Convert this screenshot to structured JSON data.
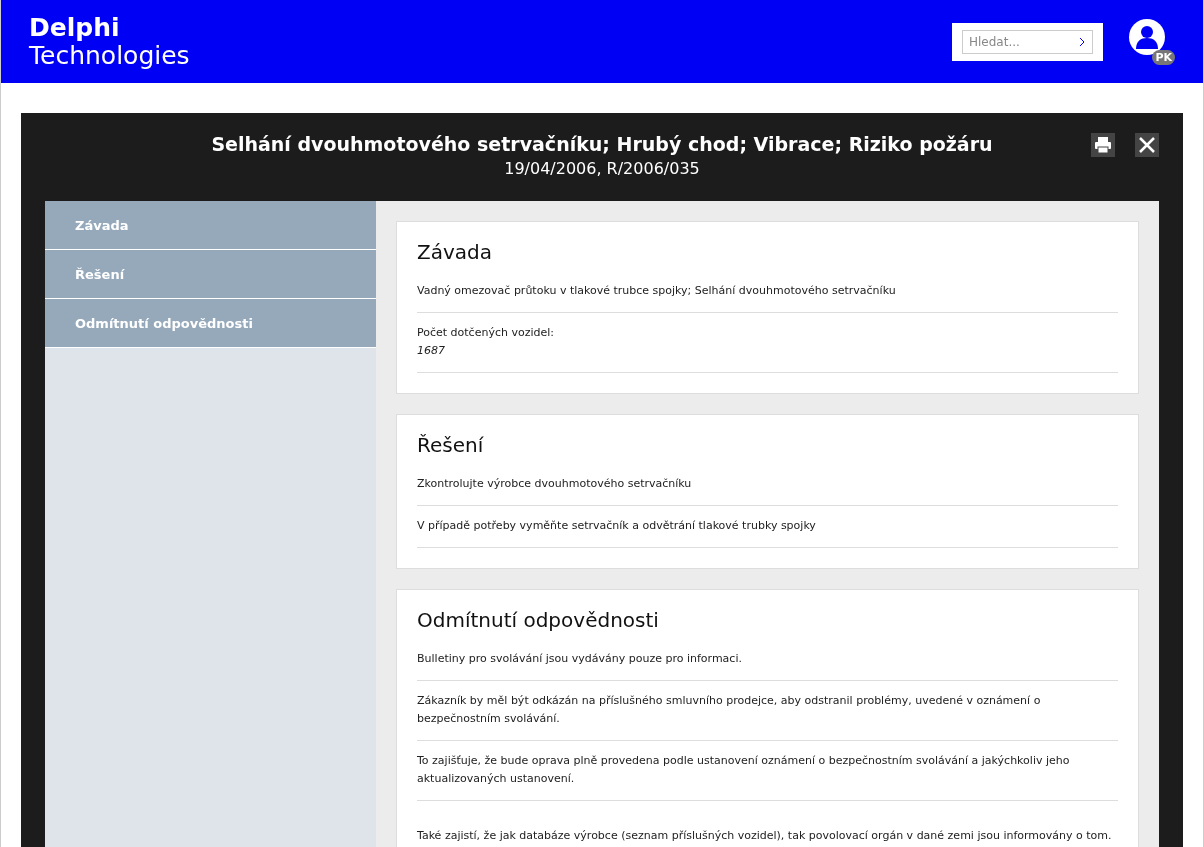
{
  "header": {
    "logo_line1": "Delphi",
    "logo_line2": "Technologies",
    "search": {
      "placeholder": "Hledat..."
    },
    "user_initials": "PK"
  },
  "modal": {
    "title": "Selhání dvouhmotového setrvačníku; Hrubý chod; Vibrace; Riziko požáru",
    "subtitle": "19/04/2006, R/2006/035"
  },
  "sidebar": {
    "items": [
      {
        "label": "Závada",
        "selected": false
      },
      {
        "label": "Řešení",
        "selected": false
      },
      {
        "label": "Odmítnutí odpovědnosti",
        "selected": false
      }
    ]
  },
  "sections": [
    {
      "title": "Závada",
      "items": [
        {
          "kind": "text",
          "text": "Vadný omezovač průtoku v tlakové trubce spojky; Selhání dvouhmotového setrvačníku"
        },
        {
          "kind": "field",
          "label": "Počet dotčených vozidel:",
          "value": "1687"
        }
      ]
    },
    {
      "title": "Řešení",
      "items": [
        {
          "kind": "text",
          "text": "Zkontrolujte výrobce dvouhmotového setrvačníku"
        },
        {
          "kind": "text",
          "text": "V případě potřeby vyměňte setrvačník a odvětrání tlakové trubky spojky"
        }
      ]
    },
    {
      "title": "Odmítnutí odpovědnosti",
      "items": [
        {
          "kind": "text",
          "text": "Bulletiny pro svolávání jsou vydávány pouze pro informaci."
        },
        {
          "kind": "text",
          "text": "Zákazník by měl být odkázán na příslušného smluvního prodejce, aby odstranil problémy, uvedené v oznámení o bezpečnostním svolávání."
        },
        {
          "kind": "text",
          "text": "To zajišťuje, že bude oprava plně provedena podle ustanovení oznámení o bezpečnostním svolávání a jakýchkoliv jeho aktualizovaných ustanovení."
        },
        {
          "kind": "spaced",
          "text": "Také zajistí, že jak databáze výrobce (seznam příslušných vozidel), tak povolovací orgán v dané zemi jsou informovány o tom."
        }
      ]
    }
  ]
}
